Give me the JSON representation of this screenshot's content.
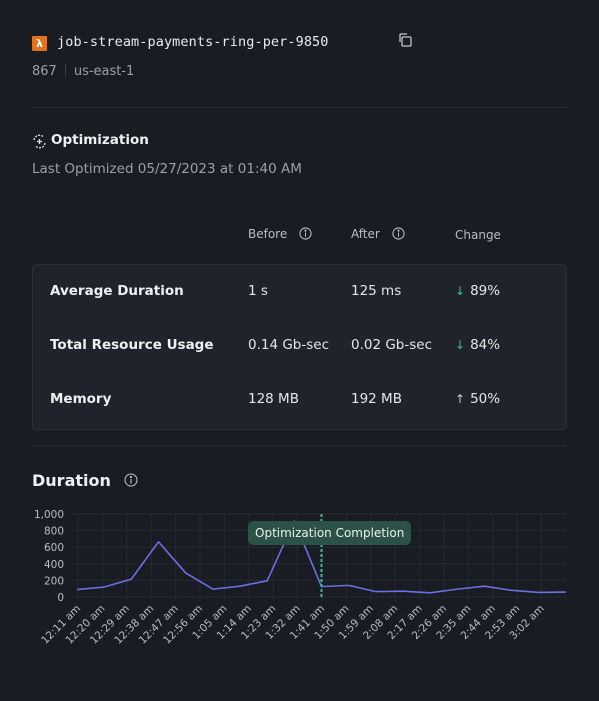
{
  "header": {
    "function_icon": "lambda-icon",
    "function_name": "job-stream-payments-ring-per-9850",
    "copy_icon": "copy-icon",
    "account": "867",
    "region": "us-east-1"
  },
  "optimization": {
    "icon": "optimization-icon",
    "title": "Optimization",
    "last_optimized": "Last Optimized 05/27/2023 at 01:40 AM",
    "columns": {
      "before": "Before",
      "after": "After",
      "change": "Change"
    },
    "rows": [
      {
        "label": "Average Duration",
        "before": "1 s",
        "after": "125 ms",
        "direction": "down",
        "change": "89%"
      },
      {
        "label": "Total Resource Usage",
        "before": "0.14 Gb-sec",
        "after": "0.02 Gb-sec",
        "direction": "down",
        "change": "84%"
      },
      {
        "label": "Memory",
        "before": "128 MB",
        "after": "192 MB",
        "direction": "up",
        "change": "50%"
      }
    ],
    "arrow_down": "↓",
    "arrow_up": "↑",
    "colors": {
      "down": "#3fbf8f",
      "up": "#c7ccd4"
    }
  },
  "duration": {
    "title": "Duration",
    "badge": "Optimization Completion"
  },
  "chart_data": {
    "type": "line",
    "title": "Duration",
    "xlabel": "",
    "ylabel": "",
    "ylim": [
      0,
      1000
    ],
    "yticks": [
      0,
      200,
      400,
      600,
      800,
      1000
    ],
    "ytick_labels": [
      "0",
      "200",
      "400",
      "600",
      "800",
      "1,000"
    ],
    "x_tick_labels": [
      "12:11 am",
      "12:20 am",
      "12:29 am",
      "12:38 am",
      "12:47 am",
      "12:56 am",
      "1:05 am",
      "1:14 am",
      "1:23 am",
      "1:32 am",
      "1:41 am",
      "1:50 am",
      "1:59 am",
      "2:08 am",
      "2:17 am",
      "2:26 am",
      "2:35 am",
      "2:44 am",
      "2:53 am",
      "3:02 am"
    ],
    "grid": true,
    "legend": "none",
    "series": [
      {
        "name": "Duration",
        "color": "#6b6fe0",
        "values": [
          90,
          120,
          215,
          665,
          290,
          95,
          130,
          195,
          915,
          125,
          140,
          65,
          70,
          50,
          95,
          130,
          80,
          55,
          60
        ]
      }
    ],
    "annotation": {
      "label": "Optimization Completion",
      "at_point_index": 9,
      "color": "#3fbf8f"
    }
  }
}
